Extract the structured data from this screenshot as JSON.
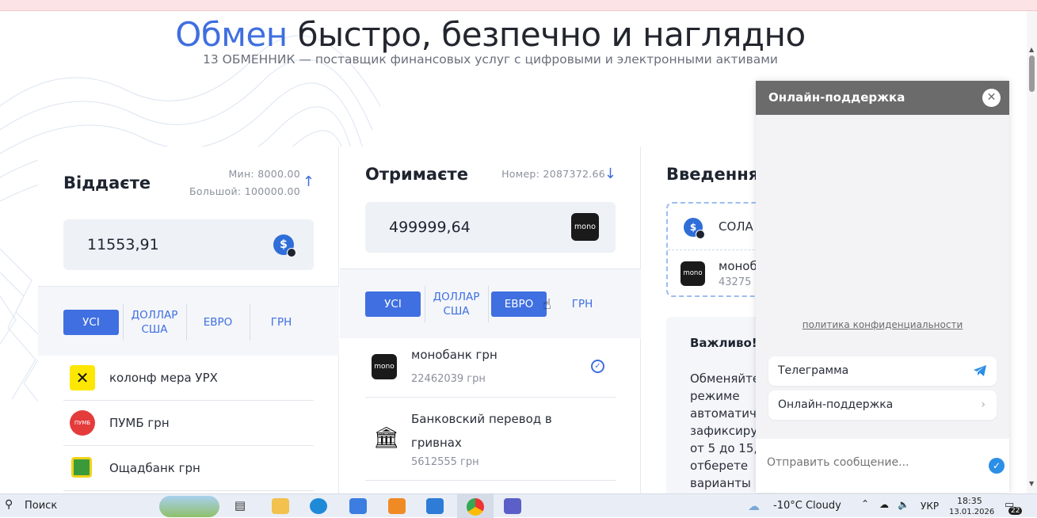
{
  "hero": {
    "title_accent": "Обмен",
    "title_rest": "быстро, безпечно и наглядно",
    "subtitle": "13 ОБМЕННИК — поставщик финансовых услуг с цифровыми и электронными активами"
  },
  "give": {
    "title": "Віддаєте",
    "min_label": "Мин: 8000.00",
    "max_label": "Большой: 100000.00",
    "amount": "11553,91",
    "tabs": [
      "УСІ",
      "ДОЛЛАР США",
      "ЕВРО",
      "ГРН"
    ],
    "banks": [
      {
        "name": "колонф мера УРХ"
      },
      {
        "name": "ПУМБ грн"
      },
      {
        "name": "Ощадбанк грн"
      }
    ]
  },
  "receive": {
    "title": "Отримаєте",
    "number_label": "Номер: 2087372.66",
    "amount": "499999,64",
    "logo_text": "mono",
    "tabs": [
      "УСІ",
      "ДОЛЛАР США",
      "ЕВРО",
      "ГРН"
    ],
    "banks": [
      {
        "name": "монобанк грн",
        "reserve": "22462039 грн",
        "logo": "mono"
      },
      {
        "name": "Банковский перевод в гривнах",
        "reserve": "5612555 грн"
      }
    ]
  },
  "entry": {
    "title": "Введення",
    "summary_give": "СОЛА",
    "summary_receive_name": "моноб",
    "summary_receive_sub": "43275",
    "important_title": "Важливо!",
    "important_lines": [
      "Обменяйте",
      "режиме",
      "автоматич",
      "зафиксиру",
      "от 5 до 15,",
      "отберете",
      "варианты"
    ]
  },
  "chat": {
    "title": "Онлайн-поддержка",
    "privacy": "политика конфиденциальности",
    "options": [
      "Телеграмма",
      "Онлайн-поддержка"
    ],
    "input_placeholder": "Отправить сообщение..."
  },
  "taskbar": {
    "search": "Поиск",
    "weather": "-10°C  Cloudy",
    "lang": "УКР",
    "time": "18:35",
    "date": "13.01.2026",
    "notifications": "22"
  }
}
